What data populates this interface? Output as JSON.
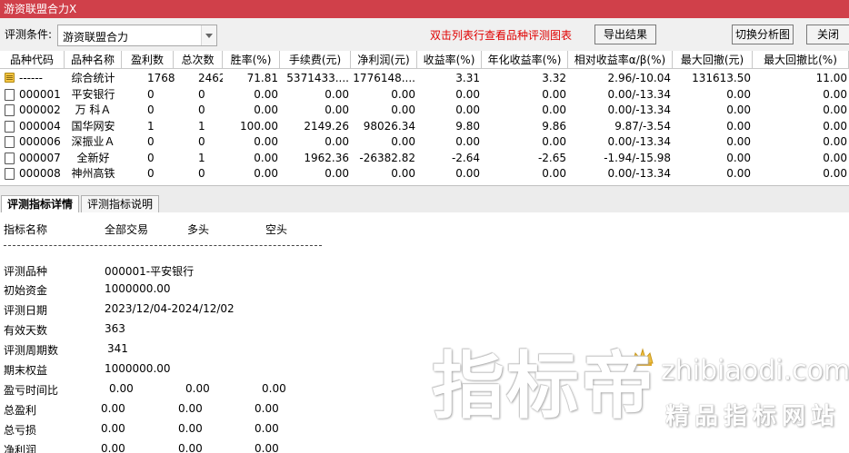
{
  "window": {
    "title": "游资联盟合力X"
  },
  "toolbar": {
    "condition_label": "评测条件:",
    "condition_value": "游资联盟合力",
    "hint": "双击列表行查看品种评测图表",
    "export_label": "导出结果",
    "switch_label": "切换分析图",
    "close_label": "关闭"
  },
  "table": {
    "columns": [
      "品种代码",
      "品种名称",
      "盈利数",
      "总次数",
      "胜率(%)",
      "手续费(元)",
      "净利润(元)",
      "收益率(%)",
      "年化收益率(%)",
      "相对收益率α/β(%)",
      "最大回撤(元)",
      "最大回撤比(%)"
    ],
    "rows": [
      [
        "------",
        "综合统计",
        "1768",
        "2462",
        "71.81",
        "5371433....",
        "1776148....",
        "3.31",
        "3.32",
        "2.96/-10.04",
        "131613.50",
        "11.00"
      ],
      [
        "000001",
        "平安银行",
        "0",
        "0",
        "0.00",
        "0.00",
        "0.00",
        "0.00",
        "0.00",
        "0.00/-13.34",
        "0.00",
        "0.00"
      ],
      [
        "000002",
        "万 科Ａ",
        "0",
        "0",
        "0.00",
        "0.00",
        "0.00",
        "0.00",
        "0.00",
        "0.00/-13.34",
        "0.00",
        "0.00"
      ],
      [
        "000004",
        "国华网安",
        "1",
        "1",
        "100.00",
        "2149.26",
        "98026.34",
        "9.80",
        "9.86",
        "9.87/-3.54",
        "0.00",
        "0.00"
      ],
      [
        "000006",
        "深振业Ａ",
        "0",
        "0",
        "0.00",
        "0.00",
        "0.00",
        "0.00",
        "0.00",
        "0.00/-13.34",
        "0.00",
        "0.00"
      ],
      [
        "000007",
        "全新好",
        "0",
        "1",
        "0.00",
        "1962.36",
        "-26382.82",
        "-2.64",
        "-2.65",
        "-1.94/-15.98",
        "0.00",
        "0.00"
      ],
      [
        "000008",
        "神州高铁",
        "0",
        "0",
        "0.00",
        "0.00",
        "0.00",
        "0.00",
        "0.00",
        "0.00/-13.34",
        "0.00",
        "0.00"
      ]
    ]
  },
  "tabs": {
    "detail": "评测指标详情",
    "explain": "评测指标说明"
  },
  "detail": {
    "header": {
      "name": "指标名称",
      "all": "全部交易",
      "long": "多头",
      "short": "空头"
    },
    "separator": "-----------------------------------------------------------------",
    "rows": [
      {
        "label": "评测品种",
        "value": "000001-平安银行"
      },
      {
        "label": "初始资金",
        "value": "1000000.00"
      },
      {
        "label": "评测日期",
        "value": "2023/12/04-2024/12/02"
      },
      {
        "label": "有效天数",
        "value": "363"
      },
      {
        "label": "评测周期数",
        "value": "341"
      },
      {
        "label": "期末权益",
        "value": "1000000.00"
      }
    ],
    "triple_rows": [
      {
        "label": "盈亏时间比",
        "all": "0.00",
        "long": "0.00",
        "short": "0.00"
      },
      {
        "label": "总盈利",
        "all": "0.00",
        "long": "0.00",
        "short": "0.00"
      },
      {
        "label": "总亏损",
        "all": "0.00",
        "long": "0.00",
        "short": "0.00"
      },
      {
        "label": "净利润",
        "all": "0.00",
        "long": "0.00",
        "short": "0.00"
      }
    ]
  },
  "watermark": {
    "brand": "指标帝",
    "url": "zhibiaodi.com",
    "slogan": "精品指标网站"
  },
  "colors": {
    "titlebar": "#d0404a",
    "hint": "#e00000"
  }
}
